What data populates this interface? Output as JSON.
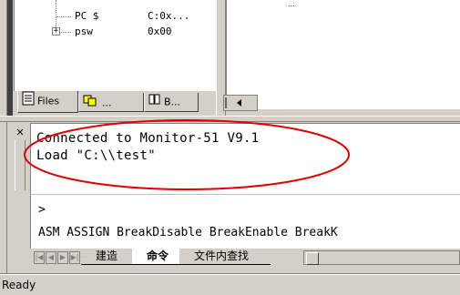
{
  "tree": {
    "rows": [
      {
        "name": "PC  $",
        "value": "C:0x..."
      },
      {
        "name": "psw",
        "value": "0x00"
      }
    ],
    "expander_symbol": "+"
  },
  "panel_tabs": [
    {
      "label": "Files",
      "icon": "files-icon"
    },
    {
      "label": "...",
      "icon": "registers-icon"
    },
    {
      "label": "B...",
      "icon": "books-icon"
    }
  ],
  "editor": {
    "snippet": "..."
  },
  "output": {
    "lines": [
      "Connected to Monitor-51 V9.1",
      "Load \"C:\\\\test\""
    ]
  },
  "command": {
    "prompt": ">",
    "hints": "ASM ASSIGN BreakDisable BreakEnable BreakK"
  },
  "bottom_tabs": [
    {
      "label": "建造",
      "active": false
    },
    {
      "label": "命令",
      "active": true
    },
    {
      "label": "文件内查找",
      "active": false
    }
  ],
  "status": {
    "text": "Ready"
  },
  "colors": {
    "chrome": "#d4d0c8",
    "annotation": "#e00000"
  }
}
